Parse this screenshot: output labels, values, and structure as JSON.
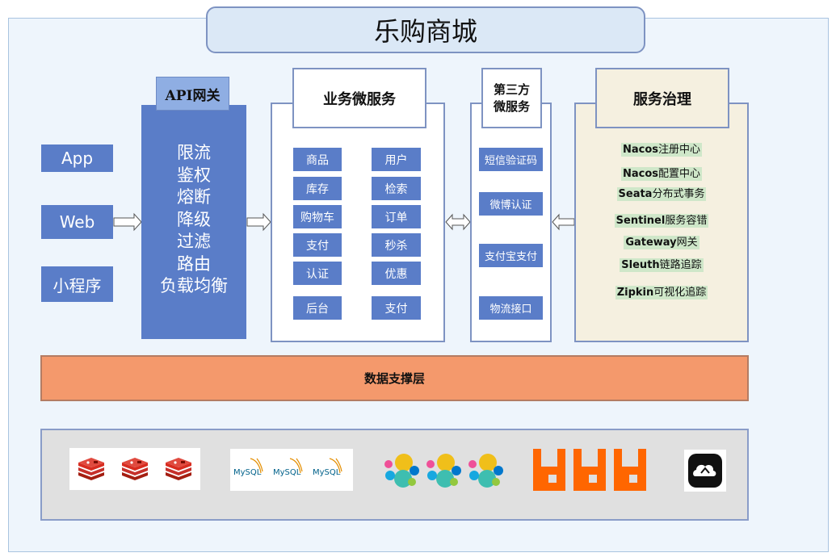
{
  "title": "乐购商城",
  "clients": [
    "App",
    "Web",
    "小程序"
  ],
  "gateway": {
    "title": "API网关",
    "items": [
      "限流",
      "鉴权",
      "熔断",
      "降级",
      "过滤",
      "路由",
      "负载均衡"
    ]
  },
  "business": {
    "title": "业务微服务",
    "services": [
      "商品",
      "用户",
      "库存",
      "检索",
      "购物车",
      "订单",
      "支付",
      "秒杀",
      "认证",
      "优惠",
      "后台",
      "支付"
    ]
  },
  "third_party": {
    "title_line1": "第三方",
    "title_line2": "微服务",
    "services": [
      "短信验证码",
      "微博认证",
      "支付宝支付",
      "物流接口"
    ]
  },
  "governance": {
    "title": "服务治理",
    "items": [
      {
        "name": "Nacos",
        "desc": "注册中心"
      },
      {
        "name": "Nacos",
        "desc": "配置中心"
      },
      {
        "name": "Seata",
        "desc": "分布式事务"
      },
      {
        "name": "Sentinel",
        "desc": "服务容错"
      },
      {
        "name": "Gateway",
        "desc": "网关"
      },
      {
        "name": "Sleuth",
        "desc": "链路追踪"
      },
      {
        "name": "Zipkin",
        "desc": "可视化追踪"
      }
    ]
  },
  "data_layer": {
    "label": "数据支撑层"
  },
  "storage": {
    "mysql_logo_text": "MySQL",
    "icons": [
      "redis-icon",
      "mysql-icon",
      "elasticsearch-icon",
      "rabbitmq-icon",
      "cloud-storage-icon"
    ]
  },
  "colors": {
    "service_blue": "#5a7dc8",
    "gateway_title": "#8faee3",
    "data_layer": "#f4996c",
    "governance_bg": "#f5f0e0",
    "governance_highlight": "#cfe7c9"
  }
}
